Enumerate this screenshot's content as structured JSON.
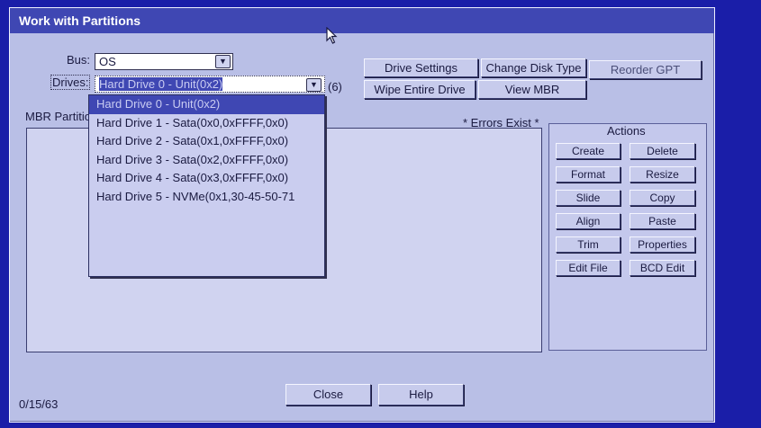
{
  "window": {
    "title": "Work with Partitions"
  },
  "bus": {
    "label": "Bus:",
    "value": "OS"
  },
  "drives": {
    "label": "Drives:",
    "value": "Hard Drive 0 - Unit(0x2)",
    "count": "(6)",
    "options": [
      "Hard Drive 0 - Unit(0x2)",
      "Hard Drive 1 - Sata(0x0,0xFFFF,0x0)",
      "Hard Drive 2 - Sata(0x1,0xFFFF,0x0)",
      "Hard Drive 3 - Sata(0x2,0xFFFF,0x0)",
      "Hard Drive 4 - Sata(0x3,0xFFFF,0x0)",
      "Hard Drive 5 - NVMe(0x1,30-45-50-71"
    ]
  },
  "top_buttons": {
    "drive_settings": "Drive Settings",
    "change_disk_type": "Change Disk Type",
    "reorder_gpt": "Reorder GPT",
    "wipe_entire_drive": "Wipe Entire Drive",
    "view_mbr": "View MBR"
  },
  "partitions": {
    "label": "MBR Partitio",
    "errors": "* Errors Exist *"
  },
  "actions": {
    "title": "Actions",
    "buttons": [
      "Create",
      "Delete",
      "Format",
      "Resize",
      "Slide",
      "Copy",
      "Align",
      "Paste",
      "Trim",
      "Properties",
      "Edit File",
      "BCD Edit"
    ]
  },
  "footer": {
    "status": "0/15/63",
    "close": "Close",
    "help": "Help"
  },
  "colors": {
    "background": "#1a1ea8",
    "dialog": "#b9bfe6",
    "titlebar": "#3f47b3",
    "selection": "#3f47b3"
  }
}
